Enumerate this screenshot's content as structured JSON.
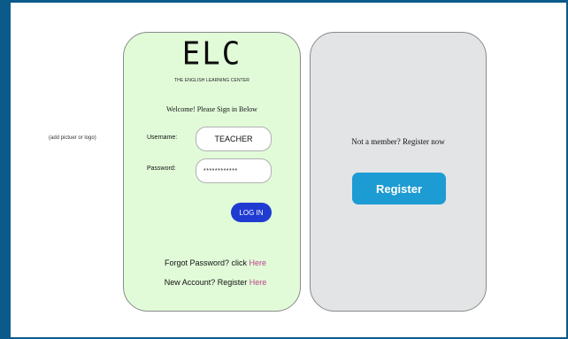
{
  "placeholder_note": "(add pictuer or logo)",
  "login": {
    "logo_text": "ELC",
    "logo_subtitle": "THE ENGLISH LEARNING CENTER",
    "welcome": "Welcome! Please Sign in Below",
    "username_label": "Username:",
    "username_value": "TEACHER",
    "password_label": "Password:",
    "password_value": "************",
    "login_button": "LOG IN",
    "forgot_text": "Forgot Password? click ",
    "forgot_link": "Here",
    "new_account_text": "New Account? Register ",
    "new_account_link": "Here"
  },
  "register": {
    "prompt": "Not a member? Register now",
    "button": "Register"
  },
  "colors": {
    "frame": "#0a5a8a",
    "login_card_bg": "#e1fbd9",
    "register_card_bg": "#e2e4e6",
    "login_button_bg": "#1f3bd1",
    "register_button_bg": "#1d9bd3",
    "link": "#c0428a"
  }
}
